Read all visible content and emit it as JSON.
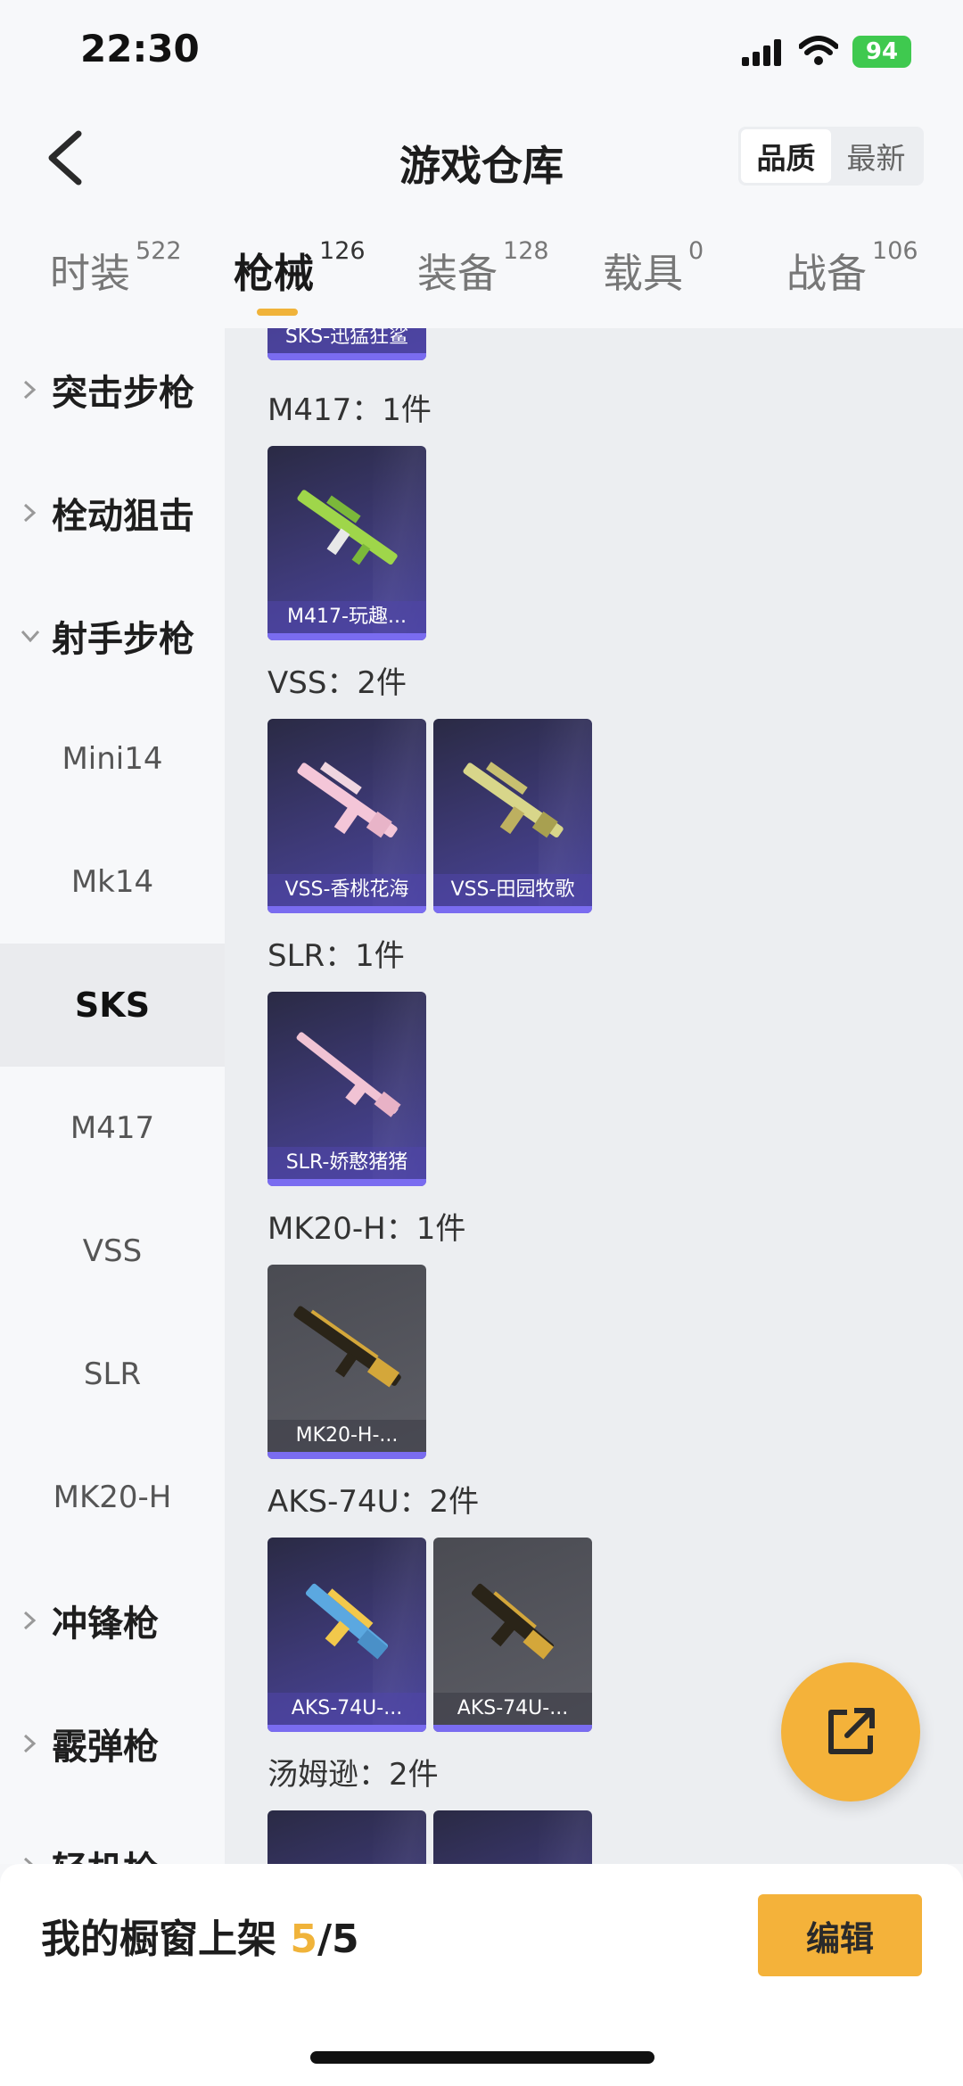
{
  "status": {
    "time": "22:30",
    "battery": "94"
  },
  "header": {
    "title": "游戏仓库",
    "sort_quality": "品质",
    "sort_newest": "最新"
  },
  "tabs": [
    {
      "label": "时装",
      "count": "522"
    },
    {
      "label": "枪械",
      "count": "126"
    },
    {
      "label": "装备",
      "count": "128"
    },
    {
      "label": "载具",
      "count": "0"
    },
    {
      "label": "战备",
      "count": "106"
    }
  ],
  "sidebar": {
    "items": [
      {
        "label": "突击步枪"
      },
      {
        "label": "栓动狙击"
      },
      {
        "label": "射手步枪"
      },
      {
        "label": "Mini14"
      },
      {
        "label": "Mk14"
      },
      {
        "label": "SKS"
      },
      {
        "label": "M417"
      },
      {
        "label": "VSS"
      },
      {
        "label": "SLR"
      },
      {
        "label": "MK20-H"
      },
      {
        "label": "冲锋枪"
      },
      {
        "label": "霰弹枪"
      },
      {
        "label": "轻机枪"
      }
    ]
  },
  "content": {
    "top_card": "SKS-迅猛狂鲨",
    "groups": [
      {
        "label": "M417：1件",
        "items": [
          "M417-玩趣..."
        ]
      },
      {
        "label": "VSS：2件",
        "items": [
          "VSS-香桃花海",
          "VSS-田园牧歌"
        ]
      },
      {
        "label": "SLR：1件",
        "items": [
          "SLR-娇憨猪猪"
        ]
      },
      {
        "label": "MK20-H：1件",
        "items": [
          "MK20-H-..."
        ]
      },
      {
        "label": "AKS-74U：2件",
        "items": [
          "AKS-74U-...",
          "AKS-74U-..."
        ]
      },
      {
        "label": "汤姆逊：2件",
        "items": []
      }
    ]
  },
  "bottom": {
    "showcase_prefix": "我的橱窗上架 ",
    "showcase_count": "5",
    "showcase_total": "/5",
    "edit": "编辑"
  },
  "colors": {
    "accent": "#f4b23a",
    "card_purple": "#3e3a78",
    "card_grey": "#5d5e66"
  }
}
